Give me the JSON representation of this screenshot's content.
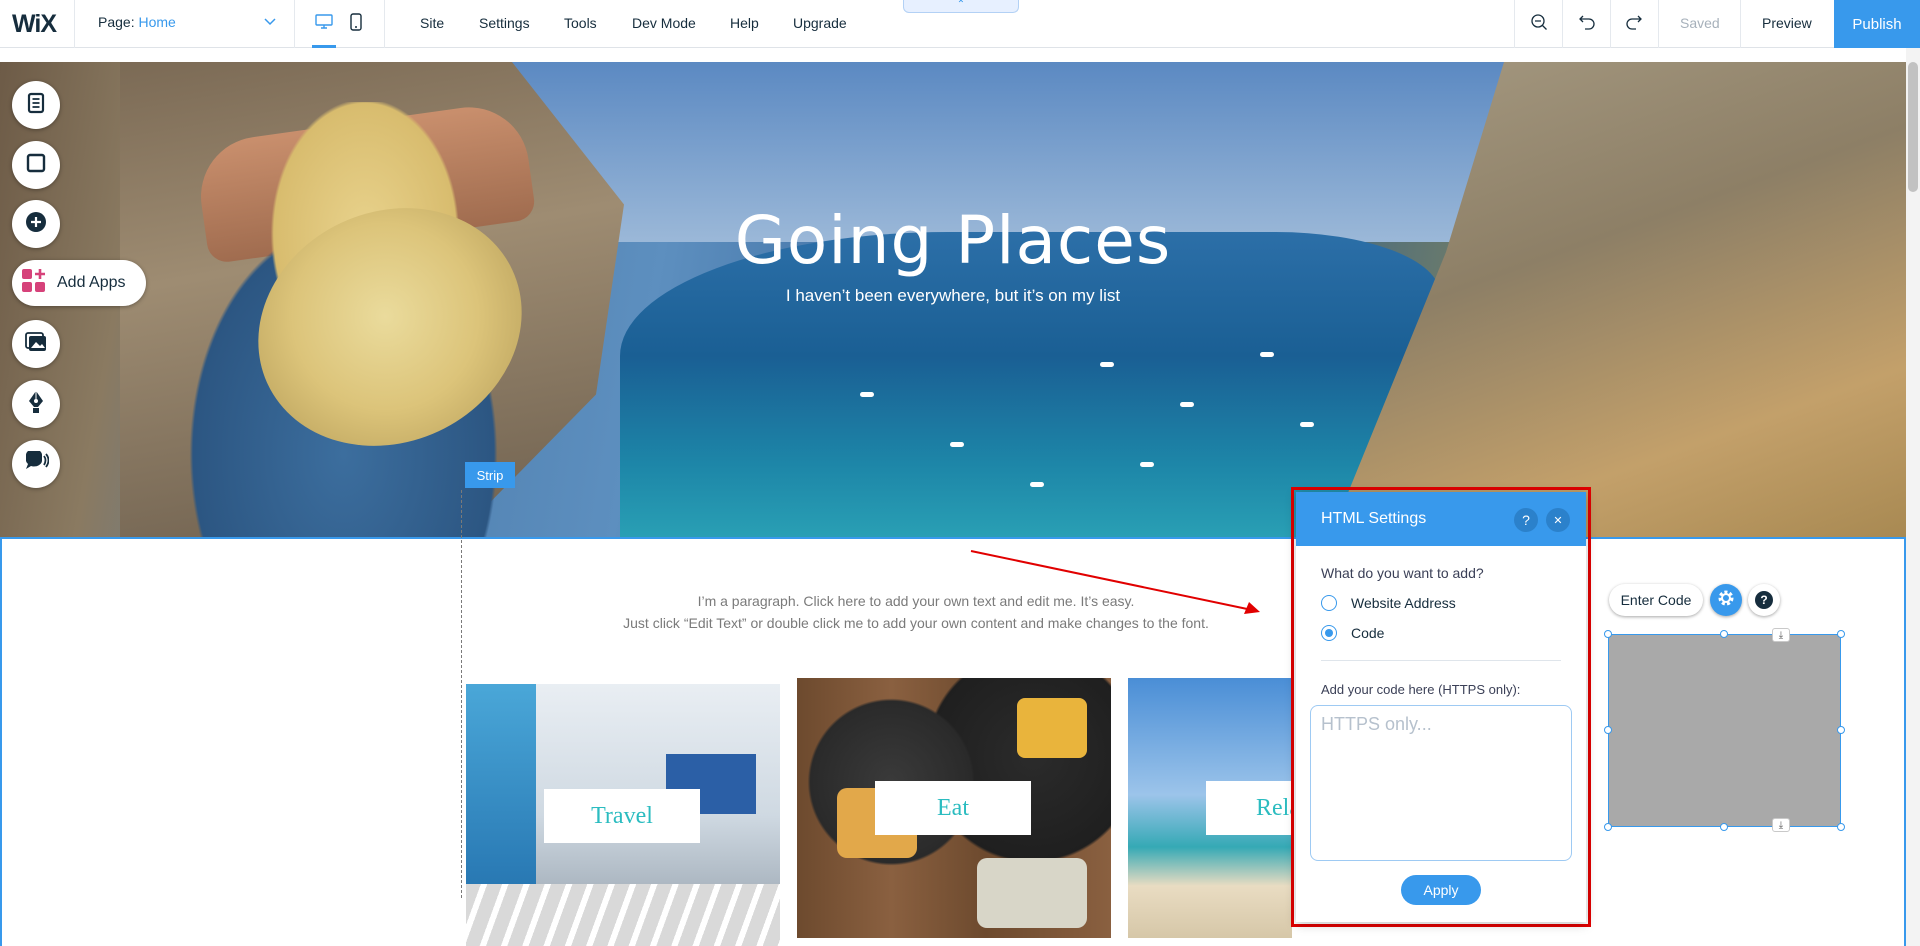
{
  "topbar": {
    "logo": "WiX",
    "page_label": "Page:",
    "page_value": "Home",
    "menu": [
      "Site",
      "Settings",
      "Tools",
      "Dev Mode",
      "Help",
      "Upgrade"
    ],
    "collapse_glyph": "⌃",
    "saved_label": "Saved",
    "preview_label": "Preview",
    "publish_label": "Publish"
  },
  "dock": {
    "add_apps_label": "Add Apps"
  },
  "hero": {
    "title": "Going Places",
    "subtitle": "I haven’t been everywhere, but it’s on my list"
  },
  "strip": {
    "tag": "Strip",
    "paragraph_line1": "I’m a paragraph. Click here to add your own text and edit me. It’s easy.",
    "paragraph_line2": "Just click “Edit Text” or double click me to add your own content and make changes to the font."
  },
  "cards": [
    {
      "label": "Travel"
    },
    {
      "label": "Eat"
    },
    {
      "label": "Rela"
    }
  ],
  "html_settings": {
    "title": "HTML Settings",
    "help_glyph": "?",
    "close_glyph": "✕",
    "question": "What do you want to add?",
    "options": [
      {
        "label": "Website Address",
        "checked": false
      },
      {
        "label": "Code",
        "checked": true
      }
    ],
    "code_label": "Add your code here (HTTPS only):",
    "code_value": "",
    "code_placeholder": "HTTPS only...",
    "apply_label": "Apply"
  },
  "html_component": {
    "enter_code_label": "Enter Code",
    "help_glyph": "?"
  },
  "colors": {
    "accent": "#3899ec",
    "highlight": "#e10000",
    "card_text": "#2bbcc0"
  }
}
